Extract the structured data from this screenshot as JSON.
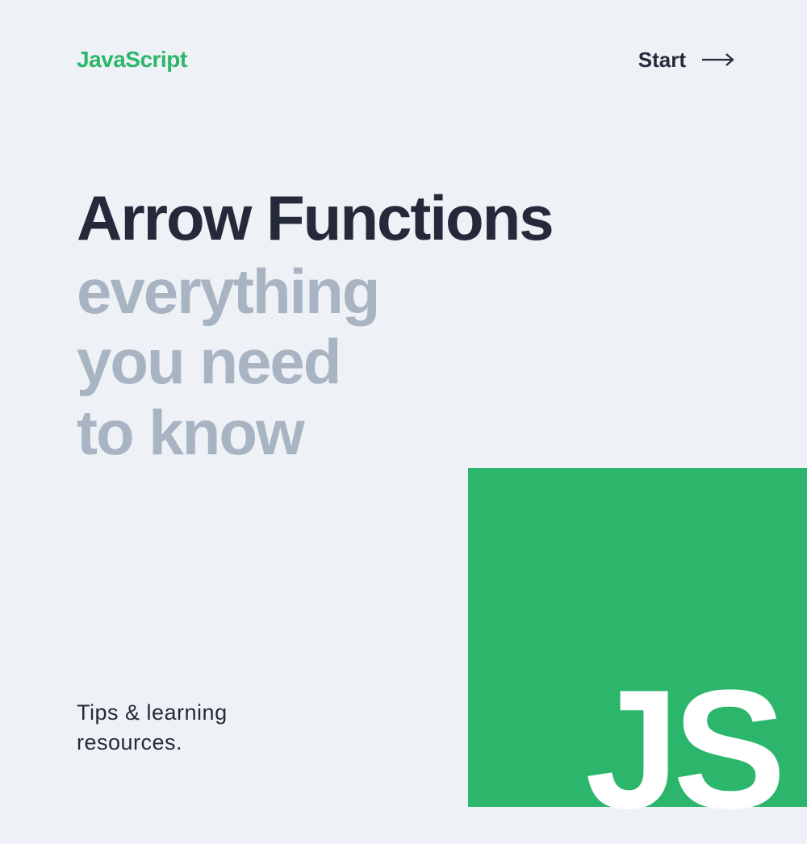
{
  "header": {
    "brand": "JavaScript",
    "start_label": "Start"
  },
  "main": {
    "title_primary": "Arrow Functions",
    "title_secondary_line1": "everything",
    "title_secondary_line2": "you need",
    "title_secondary_line3": "to know"
  },
  "footer": {
    "line1": "Tips & learning",
    "line2": "resources."
  },
  "badge": {
    "text": "JS"
  },
  "colors": {
    "accent_green": "#2cb66b",
    "dark": "#252a3b",
    "muted": "#a9b4c3",
    "bg": "#eef1f5"
  }
}
